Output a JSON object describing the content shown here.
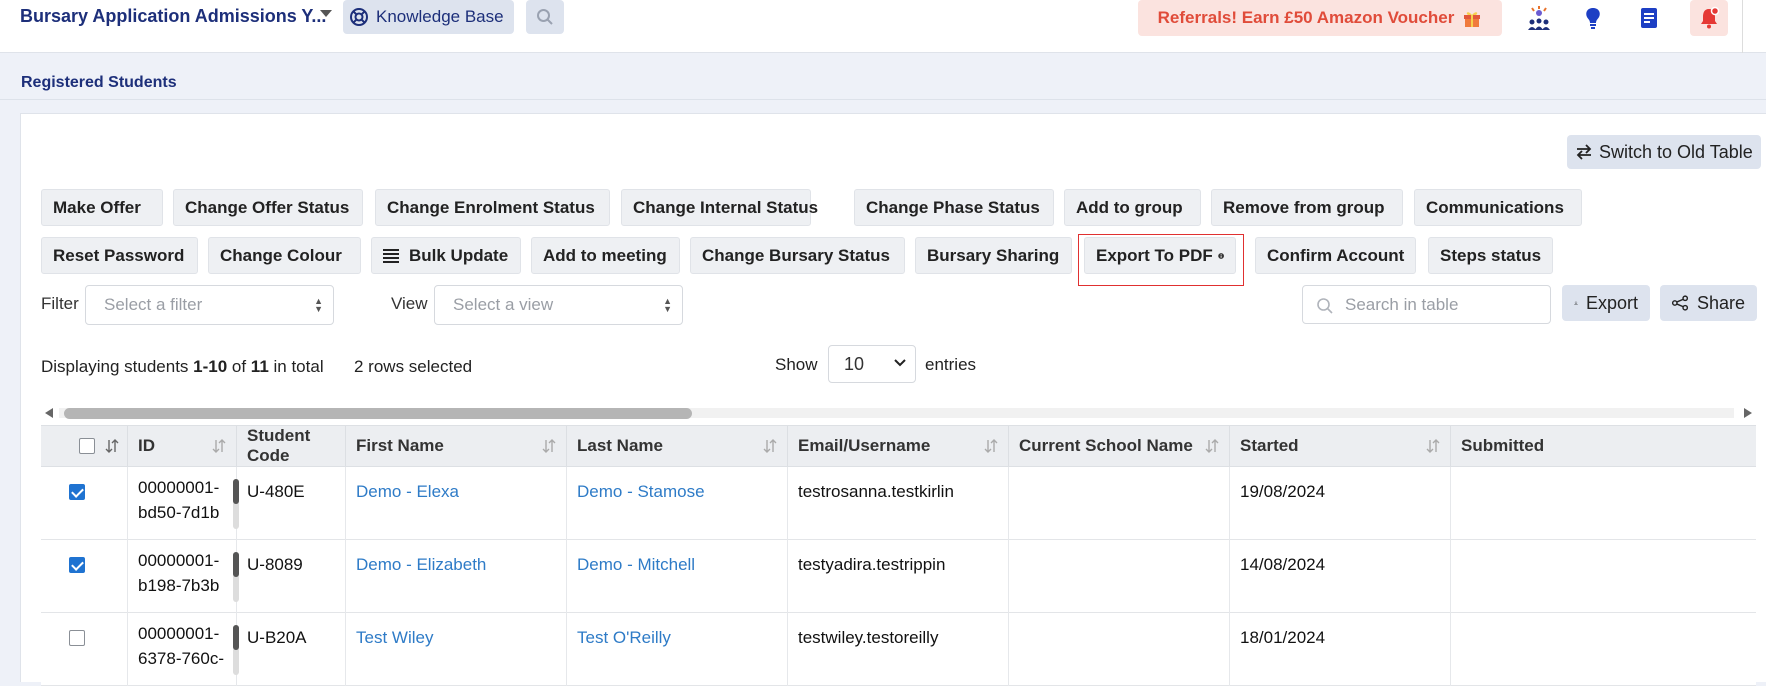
{
  "topbar": {
    "app_title": "Bursary Application Admissions Y...",
    "knowledge_base": "Knowledge Base",
    "referral": "Referrals! Earn £50 Amazon Voucher"
  },
  "page": {
    "heading": "Registered Students"
  },
  "switch_table": "Switch to Old Table",
  "actions_row1": [
    "Make Offer",
    "Change Offer Status",
    "Change Enrolment Status",
    "Change Internal Status",
    "Change Phase Status",
    "Add to group",
    "Remove from group",
    "Communications"
  ],
  "actions_row2": [
    "Reset Password",
    "Change Colour",
    "Bulk Update",
    "Add to meeting",
    "Change Bursary Status",
    "Bursary Sharing",
    "Export To PDF",
    "Confirm Account",
    "Steps status"
  ],
  "filter": {
    "label": "Filter",
    "placeholder": "Select a filter"
  },
  "view": {
    "label": "View",
    "placeholder": "Select a view"
  },
  "search": {
    "placeholder": "Search in table"
  },
  "tools": {
    "export": "Export",
    "share": "Share"
  },
  "summary": {
    "prefix": "Displaying students ",
    "range": "1-10",
    "of": " of ",
    "total": "11",
    "suffix": " in total",
    "selected": "2 rows selected"
  },
  "entries": {
    "show": "Show",
    "value": "10",
    "label": "entries"
  },
  "table": {
    "columns": [
      "ID",
      "Student Code",
      "First Name",
      "Last Name",
      "Email/Username",
      "Current School Name",
      "Started",
      "Submitted"
    ],
    "rows": [
      {
        "checked": true,
        "id_line1": "00000001-",
        "id_line2": "bd50-7d1b",
        "code": "U-480E",
        "first": "Demo - Elexa",
        "last": "Demo - Stamose",
        "email": "testrosanna.testkirlin",
        "school": "",
        "started": "19/08/2024",
        "submitted": ""
      },
      {
        "checked": true,
        "id_line1": "00000001-",
        "id_line2": "b198-7b3b",
        "code": "U-8089",
        "first": "Demo - Elizabeth",
        "last": "Demo - Mitchell",
        "email": "testyadira.testrippin",
        "school": "",
        "started": "14/08/2024",
        "submitted": ""
      },
      {
        "checked": false,
        "id_line1": "00000001-",
        "id_line2": "6378-760c-",
        "code": "U-B20A",
        "first": "Test Wiley",
        "last": "Test O'Reilly",
        "email": "testwiley.testoreilly",
        "school": "",
        "started": "18/01/2024",
        "submitted": ""
      }
    ]
  }
}
